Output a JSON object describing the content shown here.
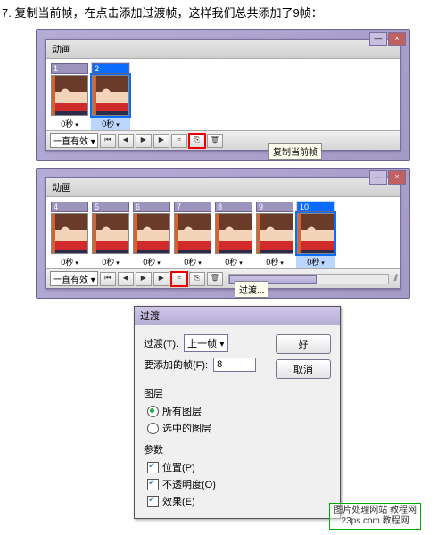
{
  "instruction": "7. 复制当前帧，在点击添加过渡帧，这样我们总共添加了9帧：",
  "panel1": {
    "tab": "动画",
    "loop": "一直有效",
    "frames": [
      {
        "num": "1",
        "time": "0秒",
        "selected": false
      },
      {
        "num": "2",
        "time": "0秒",
        "selected": true
      }
    ],
    "tooltip": "复制当前帧"
  },
  "panel2": {
    "tab": "动画",
    "loop": "一直有效",
    "frames": [
      {
        "num": "4",
        "time": "0秒",
        "selected": false
      },
      {
        "num": "5",
        "time": "0秒",
        "selected": false
      },
      {
        "num": "6",
        "time": "0秒",
        "selected": false
      },
      {
        "num": "7",
        "time": "0秒",
        "selected": false
      },
      {
        "num": "8",
        "time": "0秒",
        "selected": false
      },
      {
        "num": "9",
        "time": "0秒",
        "selected": false
      },
      {
        "num": "10",
        "time": "0秒",
        "selected": true
      }
    ],
    "tooltip": "过渡..."
  },
  "dialog": {
    "title": "过渡",
    "row_transition_label": "过渡(T):",
    "row_transition_value": "上一帧",
    "row_frames_label": "要添加的帧(F):",
    "row_frames_value": "8",
    "ok": "好",
    "cancel": "取消",
    "layers_label": "图层",
    "layers_all": "所有图层",
    "layers_sel": "选中的图层",
    "params_label": "参数",
    "param_pos": "位置(P)",
    "param_opac": "不透明度(O)",
    "param_fx": "效果(E)"
  },
  "watermark": {
    "line1": "图片处理网站 教程网",
    "line2": "23ps.com 教程网"
  },
  "icons": {
    "rewind": "⏮",
    "prev": "◀",
    "play": "▶",
    "next": "▶",
    "tween": "≈",
    "dup": "⎘",
    "del": "🗑"
  }
}
